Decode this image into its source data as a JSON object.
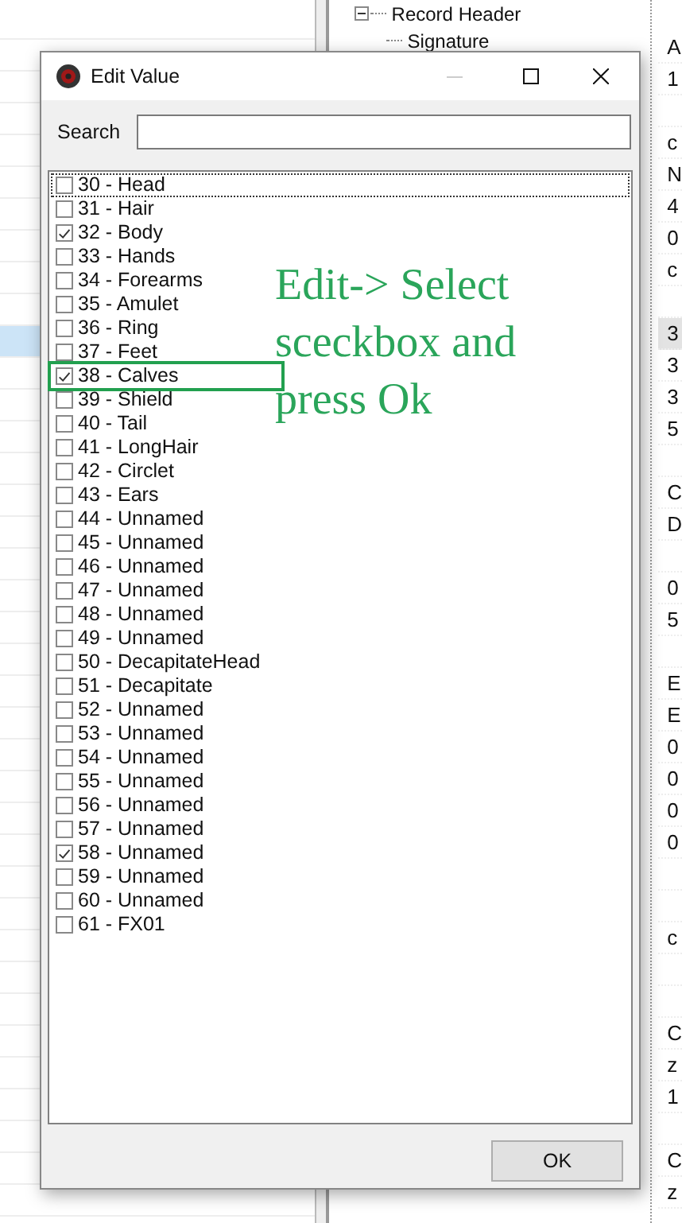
{
  "left_pane": {
    "rows": [
      {
        "selected": false
      },
      {
        "selected": false
      },
      {
        "selected": false
      },
      {
        "selected": false
      },
      {
        "selected": false
      },
      {
        "selected": false
      },
      {
        "selected": false
      },
      {
        "selected": false
      },
      {
        "selected": false
      },
      {
        "selected": false
      },
      {
        "selected": true
      },
      {
        "selected": false
      },
      {
        "selected": false
      },
      {
        "selected": false
      },
      {
        "selected": false
      },
      {
        "selected": false
      },
      {
        "selected": false
      },
      {
        "selected": false
      },
      {
        "selected": false
      },
      {
        "selected": false
      },
      {
        "selected": false
      },
      {
        "selected": false
      },
      {
        "selected": false
      },
      {
        "selected": false
      },
      {
        "selected": false
      },
      {
        "selected": false
      },
      {
        "selected": false
      },
      {
        "selected": false
      },
      {
        "selected": false
      },
      {
        "selected": false
      },
      {
        "selected": false
      },
      {
        "selected": false
      },
      {
        "selected": false
      },
      {
        "selected": false
      },
      {
        "selected": false
      },
      {
        "selected": false
      },
      {
        "selected": false
      },
      {
        "selected": false
      }
    ]
  },
  "tree": {
    "items": [
      {
        "label": "Record Header",
        "expanded": true,
        "children": [
          {
            "label": "Signature"
          }
        ]
      }
    ]
  },
  "values": [
    {
      "text": "A",
      "selected": false
    },
    {
      "text": "1",
      "selected": false
    },
    {
      "kind": "spacer",
      "selected": false
    },
    {
      "text": "c",
      "selected": false
    },
    {
      "text": "N",
      "selected": false
    },
    {
      "text": "4",
      "selected": false
    },
    {
      "text": "0",
      "selected": false
    },
    {
      "text": "c",
      "selected": false
    },
    {
      "kind": "spacer",
      "selected": false
    },
    {
      "text": "3",
      "selected": true
    },
    {
      "text": "3",
      "selected": false
    },
    {
      "text": "3",
      "selected": false
    },
    {
      "text": "5",
      "selected": false
    },
    {
      "kind": "spacer",
      "selected": false
    },
    {
      "text": "C",
      "selected": false
    },
    {
      "text": "D",
      "selected": false
    },
    {
      "kind": "spacer",
      "selected": false
    },
    {
      "text": "0",
      "selected": false
    },
    {
      "text": "5",
      "selected": false
    },
    {
      "kind": "spacer",
      "selected": false
    },
    {
      "text": "E",
      "selected": false
    },
    {
      "text": "E",
      "selected": false
    },
    {
      "text": "0",
      "selected": false
    },
    {
      "text": "0",
      "selected": false
    },
    {
      "text": "0",
      "selected": false
    },
    {
      "text": "0",
      "selected": false
    },
    {
      "kind": "spacer",
      "selected": false
    },
    {
      "kind": "spacer",
      "selected": false
    },
    {
      "text": "c",
      "selected": false
    },
    {
      "kind": "spacer",
      "selected": false
    },
    {
      "kind": "spacer",
      "selected": false
    },
    {
      "text": "C",
      "selected": false
    },
    {
      "text": "z",
      "selected": false
    },
    {
      "text": "1",
      "selected": false
    },
    {
      "kind": "spacer",
      "selected": false
    },
    {
      "text": "C",
      "selected": false
    },
    {
      "text": "z",
      "selected": false
    }
  ],
  "dialog": {
    "title": "Edit Value",
    "search": {
      "label": "Search"
    },
    "items": [
      {
        "label": "30 - Head",
        "checked": false,
        "focused": true,
        "highlighted": false
      },
      {
        "label": "31 - Hair",
        "checked": false,
        "focused": false,
        "highlighted": false
      },
      {
        "label": "32 - Body",
        "checked": true,
        "focused": false,
        "highlighted": false
      },
      {
        "label": "33 - Hands",
        "checked": false,
        "focused": false,
        "highlighted": false
      },
      {
        "label": "34 - Forearms",
        "checked": false,
        "focused": false,
        "highlighted": false
      },
      {
        "label": "35 - Amulet",
        "checked": false,
        "focused": false,
        "highlighted": false
      },
      {
        "label": "36 - Ring",
        "checked": false,
        "focused": false,
        "highlighted": false
      },
      {
        "label": "37 - Feet",
        "checked": false,
        "focused": false,
        "highlighted": false
      },
      {
        "label": "38 - Calves",
        "checked": true,
        "focused": false,
        "highlighted": true
      },
      {
        "label": "39 - Shield",
        "checked": false,
        "focused": false,
        "highlighted": false
      },
      {
        "label": "40 - Tail",
        "checked": false,
        "focused": false,
        "highlighted": false
      },
      {
        "label": "41 - LongHair",
        "checked": false,
        "focused": false,
        "highlighted": false
      },
      {
        "label": "42 - Circlet",
        "checked": false,
        "focused": false,
        "highlighted": false
      },
      {
        "label": "43 - Ears",
        "checked": false,
        "focused": false,
        "highlighted": false
      },
      {
        "label": "44 - Unnamed",
        "checked": false,
        "focused": false,
        "highlighted": false
      },
      {
        "label": "45 - Unnamed",
        "checked": false,
        "focused": false,
        "highlighted": false
      },
      {
        "label": "46 - Unnamed",
        "checked": false,
        "focused": false,
        "highlighted": false
      },
      {
        "label": "47 - Unnamed",
        "checked": false,
        "focused": false,
        "highlighted": false
      },
      {
        "label": "48 - Unnamed",
        "checked": false,
        "focused": false,
        "highlighted": false
      },
      {
        "label": "49 - Unnamed",
        "checked": false,
        "focused": false,
        "highlighted": false
      },
      {
        "label": "50 - DecapitateHead",
        "checked": false,
        "focused": false,
        "highlighted": false
      },
      {
        "label": "51 - Decapitate",
        "checked": false,
        "focused": false,
        "highlighted": false
      },
      {
        "label": "52 - Unnamed",
        "checked": false,
        "focused": false,
        "highlighted": false
      },
      {
        "label": "53 - Unnamed",
        "checked": false,
        "focused": false,
        "highlighted": false
      },
      {
        "label": "54 - Unnamed",
        "checked": false,
        "focused": false,
        "highlighted": false
      },
      {
        "label": "55 - Unnamed",
        "checked": false,
        "focused": false,
        "highlighted": false
      },
      {
        "label": "56 - Unnamed",
        "checked": false,
        "focused": false,
        "highlighted": false
      },
      {
        "label": "57 - Unnamed",
        "checked": false,
        "focused": false,
        "highlighted": false
      },
      {
        "label": "58 - Unnamed",
        "checked": true,
        "focused": false,
        "highlighted": false
      },
      {
        "label": "59 - Unnamed",
        "checked": false,
        "focused": false,
        "highlighted": false
      },
      {
        "label": "60 - Unnamed",
        "checked": false,
        "focused": false,
        "highlighted": false
      },
      {
        "label": "61 - FX01",
        "checked": false,
        "focused": false,
        "highlighted": false
      }
    ],
    "buttons": [
      "OK"
    ]
  },
  "annotation": {
    "text": "Edit-> Select sceckbox and press Ok"
  }
}
